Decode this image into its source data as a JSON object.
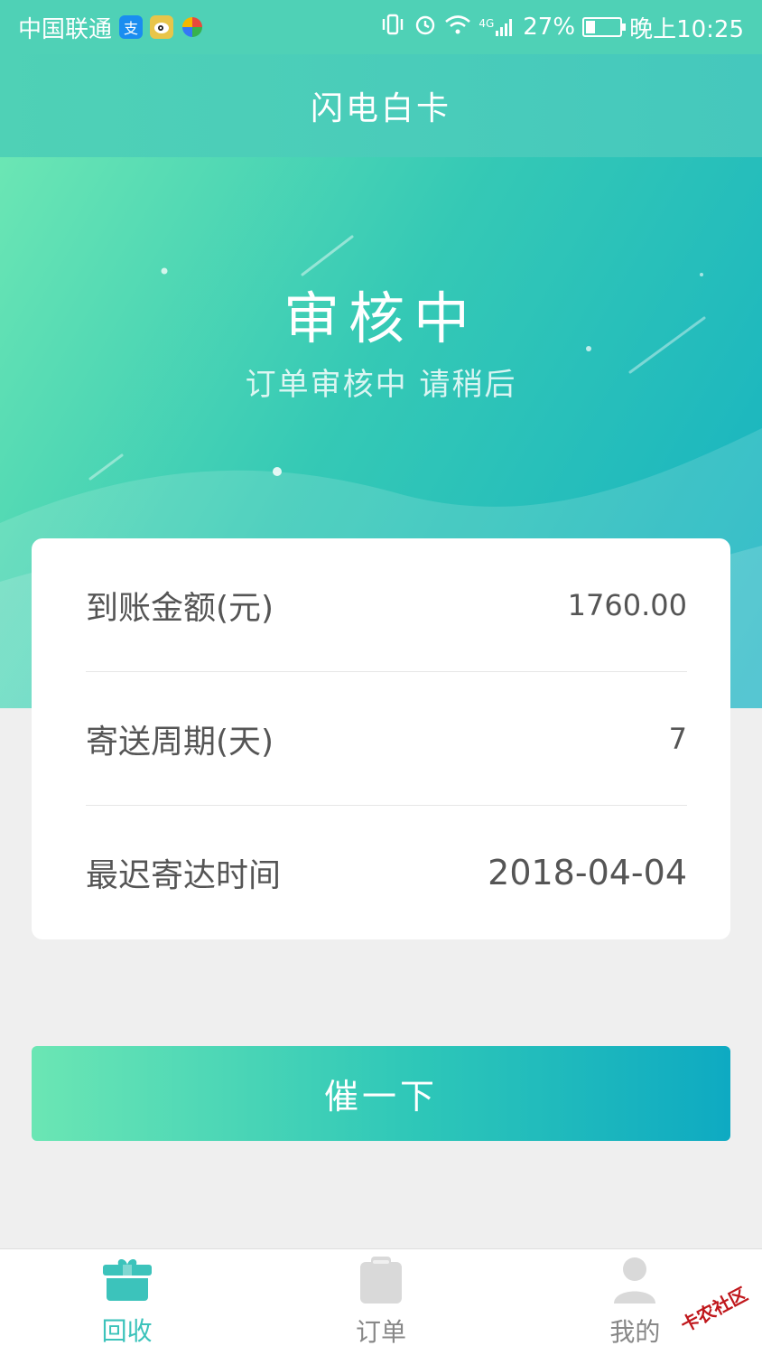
{
  "status_bar": {
    "carrier": "中国联通",
    "network": "4G",
    "battery": "27%",
    "battery_level": 0.27,
    "time": "晚上10:25",
    "app_icons": [
      "alipay-icon",
      "weibo-icon",
      "sync-app-icon"
    ],
    "system_icons": [
      "vibrate-icon",
      "alarm-icon",
      "wifi-icon",
      "signal-icon",
      "battery-icon"
    ]
  },
  "header": {
    "title": "闪电白卡"
  },
  "hero": {
    "status_title": "审核中",
    "status_subtitle": "订单审核中 请稍后"
  },
  "info": {
    "rows": [
      {
        "label": "到账金额(元)",
        "value": "1760.00"
      },
      {
        "label": "寄送周期(天)",
        "value": "7"
      },
      {
        "label": "最迟寄达时间",
        "value": "2018-04-04"
      }
    ]
  },
  "actions": {
    "urge_label": "催一下"
  },
  "bottom_nav": {
    "items": [
      {
        "label": "回收",
        "icon": "gift-box-icon",
        "active": true
      },
      {
        "label": "订单",
        "icon": "clipboard-icon",
        "active": false
      },
      {
        "label": "我的",
        "icon": "user-icon",
        "active": false
      }
    ]
  },
  "watermark": {
    "text": "卡农社区"
  },
  "colors": {
    "accent": "#3cc3bb",
    "gradient_start": "#6be6b4",
    "gradient_end": "#0eaac2",
    "background": "#efefef",
    "inactive": "#d9d9d9"
  }
}
